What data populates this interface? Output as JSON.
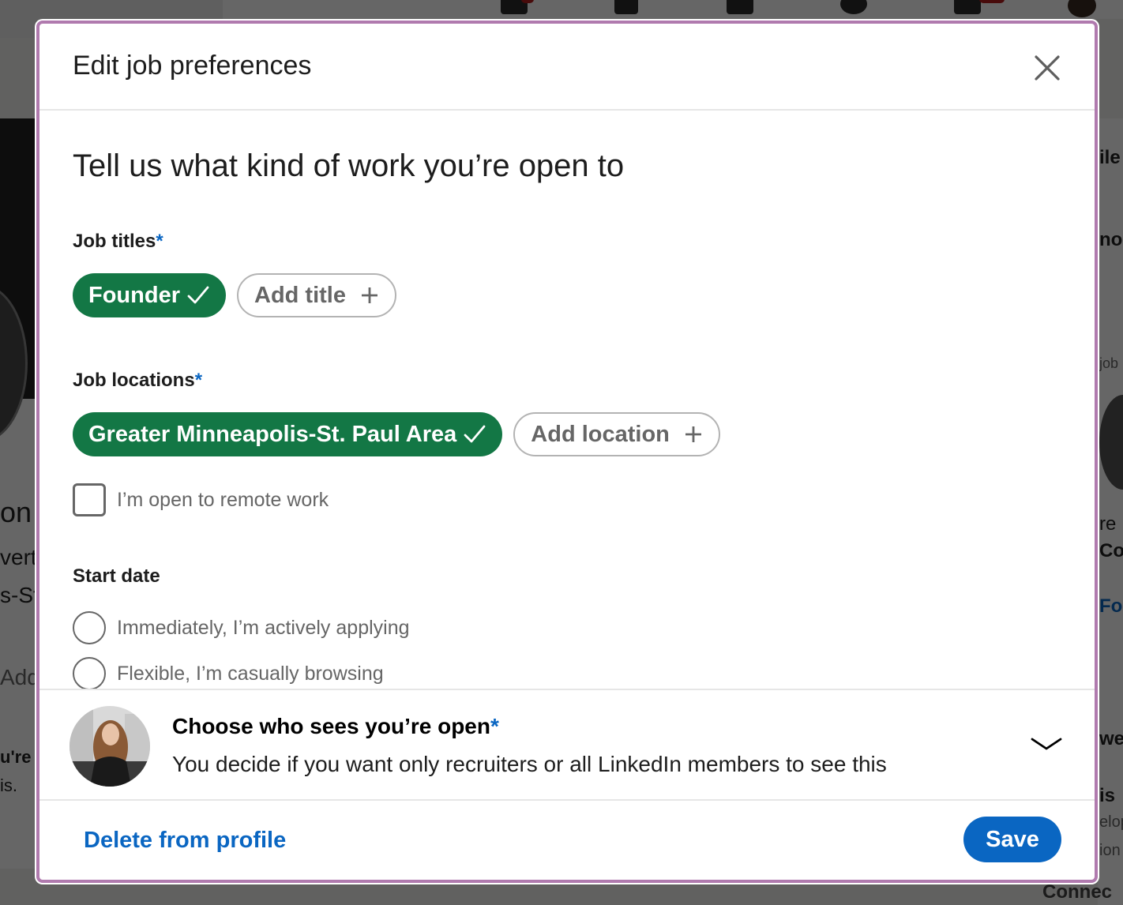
{
  "background": {
    "left_fragments": [
      "on",
      "vert",
      "s-St",
      "Add",
      "u're",
      "is."
    ],
    "right_fragments": [
      "ile",
      "no",
      "job",
      "re",
      "Co",
      "Fo",
      "we",
      "is",
      "elop",
      "ion",
      "Connec"
    ]
  },
  "modal": {
    "title": "Edit job preferences",
    "close_icon": "close-icon",
    "intro_heading": "Tell us what kind of work you’re open to",
    "job_titles": {
      "label": "Job titles",
      "required_mark": "*",
      "selected": [
        {
          "label": "Founder",
          "icon": "checkmark-icon"
        }
      ],
      "add_label": "Add title",
      "add_icon": "plus-icon"
    },
    "job_locations": {
      "label": "Job locations",
      "required_mark": "*",
      "selected": [
        {
          "label": "Greater Minneapolis-St. Paul Area",
          "icon": "checkmark-icon"
        }
      ],
      "add_label": "Add location",
      "add_icon": "plus-icon",
      "remote_checkbox": {
        "label": "I’m open to remote work",
        "checked": false
      }
    },
    "start_date": {
      "label": "Start date",
      "options": [
        {
          "label": "Immediately, I’m actively applying",
          "selected": false
        },
        {
          "label": "Flexible, I’m casually browsing",
          "selected": false
        }
      ]
    },
    "visibility": {
      "title": "Choose who sees you’re open",
      "required_mark": "*",
      "description": "You decide if you want only recruiters or all LinkedIn members to see this",
      "expand_icon": "chevron-down-icon"
    },
    "footer": {
      "delete_label": "Delete from profile",
      "save_label": "Save"
    }
  },
  "colors": {
    "accent_blue": "#0a66c2",
    "selected_chip_green": "#137745",
    "modal_border": "#b07aae"
  }
}
